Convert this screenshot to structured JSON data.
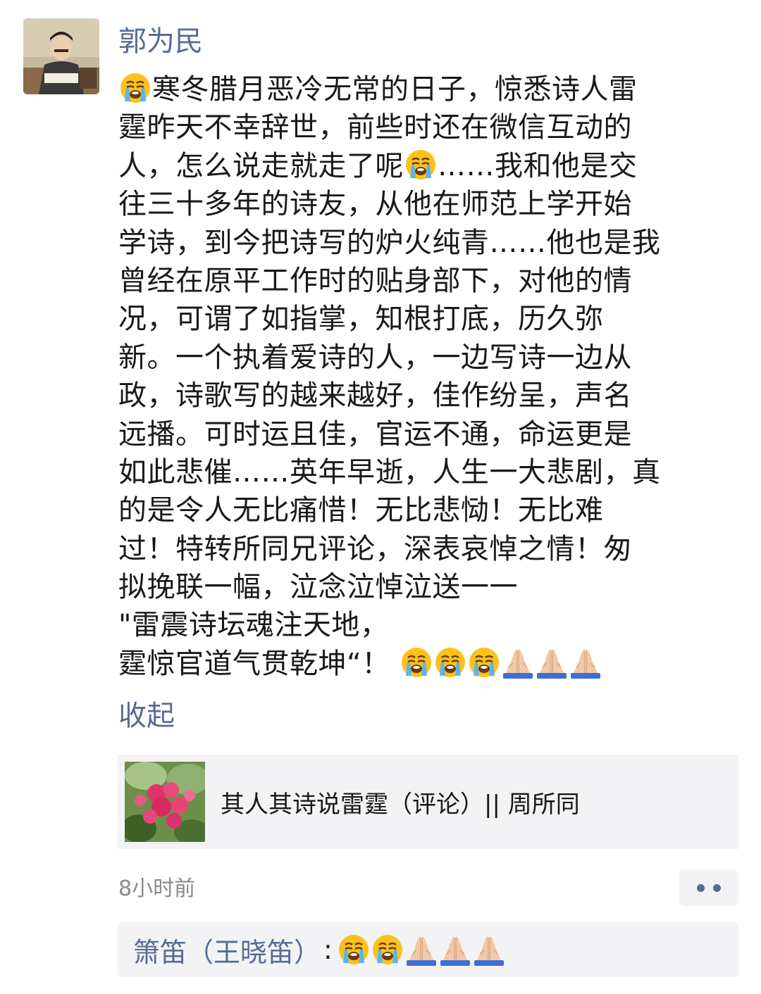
{
  "post": {
    "author": "郭为民",
    "lines": [
      "寒冬腊月恶冷无常的日子，惊悉诗人雷",
      "霆昨天不幸辞世，前些时还在微信互动的",
      "人，怎么说走就走了呢",
      "……我和他是交",
      "往三十多年的诗友，从他在师范上学开始",
      "学诗，到今把诗写的炉火纯青……他也是我",
      "曾经在原平工作时的贴身部下，对他的情",
      "况，可谓了如指掌，知根打底，历久弥",
      "新。一个执着爱诗的人，一边写诗一边从",
      "政，诗歌写的越来越好，佳作纷呈，声名",
      "远播。可时运且佳，官运不通，命运更是",
      "如此悲催……英年早逝，人生一大悲剧，真",
      "的是令人无比痛惜！无比悲恸！无比难",
      "过！特转所同兄评论，深表哀悼之情！匆",
      "拟挽联一幅，泣念泣悼泣送一一",
      "\"雷震诗坛魂注天地，",
      "霆惊官道气贯乾坤“！"
    ],
    "emoji_names": [
      "loudly-crying-face",
      "folded-hands"
    ],
    "collapse_label": "收起",
    "timestamp": "8小时前"
  },
  "shared_article": {
    "title": "其人其诗说雷霆（评论）|| 周所同"
  },
  "comment": {
    "author": "箫笛（王晓笛）",
    "colon": ":"
  },
  "colors": {
    "link_blue": "#576b95",
    "text": "#191919",
    "card_bg": "#f3f3f5",
    "timestamp_gray": "#8a8a8a"
  }
}
